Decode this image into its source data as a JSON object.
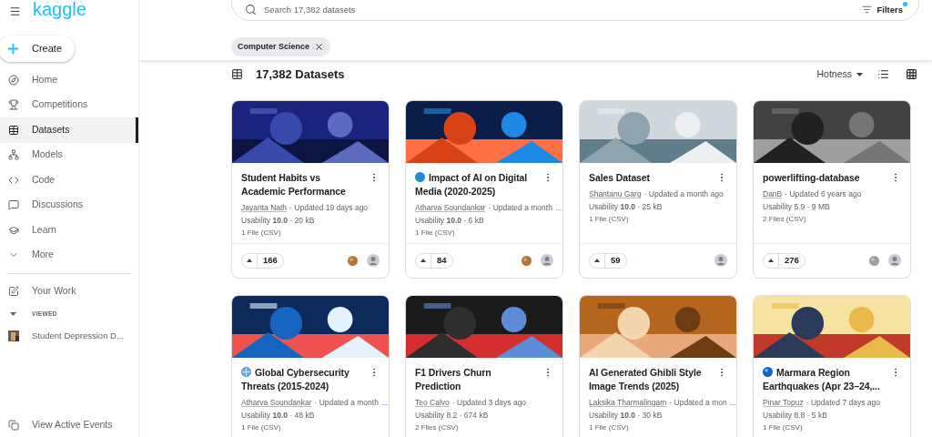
{
  "logo": "kaggle",
  "create_label": "Create",
  "nav": [
    {
      "label": "Home",
      "selected": false
    },
    {
      "label": "Competitions",
      "selected": false
    },
    {
      "label": "Datasets",
      "selected": true
    },
    {
      "label": "Models",
      "selected": false
    },
    {
      "label": "Code",
      "selected": false
    },
    {
      "label": "Discussions",
      "selected": false
    },
    {
      "label": "Learn",
      "selected": false
    },
    {
      "label": "More",
      "selected": false
    }
  ],
  "your_work": "Your Work",
  "viewed": {
    "heading": "VIEWED",
    "expanded": true,
    "items": [
      "Student Depression D..."
    ]
  },
  "active_events": "View Active Events",
  "search": {
    "placeholder": "Search 17,382 datasets"
  },
  "filters": {
    "label": "Filters",
    "active": true
  },
  "chips": [
    "Computer Science"
  ],
  "results_title": "17,382 Datasets",
  "sort": "Hotness",
  "views": [
    {
      "kind": "list",
      "selected": false
    },
    {
      "kind": "grid",
      "selected": false
    }
  ],
  "cards": [
    {
      "title": "Student Habits vs Academic Performance",
      "author": "Jayanta Nath",
      "updated": "· Updated 19 days ago",
      "usability": "Usability **10.0** · 20 kB",
      "files": "1 File (CSV)",
      "votes": "166",
      "medal": {
        "kind": "bronze"
      }
    },
    {
      "title_icon": {
        "kind": "earth"
      },
      "title": "Impact of AI on Digital Media (2020-2025)",
      "author": "Atharva Soundankar",
      "updated": "· Updated a month",
      "more": "...",
      "usability": "Usability **10.0** · 6 kB",
      "files": "1 File (CSV)",
      "votes": "84",
      "medal": {
        "kind": "bronze"
      }
    },
    {
      "title": "Sales Dataset",
      "author": "Shantanu Garg",
      "updated": "· Updated a month ago",
      "usability": "Usability **10.0** · 25 kB",
      "files": "1 File (CSV)",
      "votes": "59"
    },
    {
      "title": "powerlifting-database",
      "author": "DanB",
      "updated": "· Updated 6 years ago",
      "usability": "Usability 5.9 · 9 MB",
      "files": "2 Files (CSV)",
      "votes": "276",
      "medal": {
        "kind": "silver"
      }
    },
    {
      "title_icon": {
        "kind": "globe"
      },
      "title": "Global Cybersecurity Threats (2015-2024)",
      "author": "Atharva Soundankar",
      "updated": "· Updated a month",
      "more": "...",
      "usability": "Usability **10.0** · 48 kB",
      "files": "1 File (CSV)"
    },
    {
      "title": "F1 Drivers Churn Prediction",
      "author": "Teo Calvo",
      "updated": "· Updated 3 days ago",
      "usability": "Usability 8.2 · 674 kB",
      "files": "2 Files (CSV)"
    },
    {
      "title": "AI Generated Ghibli Style Image Trends (2025)",
      "author": "Laksika Tharmalingam",
      "updated": "· Updated a mon",
      "more": "...",
      "usability": "Usability **10.0** · 30 kB",
      "files": "1 File (CSV)"
    },
    {
      "title_icon": {
        "kind": "dot"
      },
      "title": "Marmara Region Earthquakes (Apr 23–24,...",
      "author": "Pinar Topuz",
      "updated": "· Updated 7 days ago",
      "usability": "Usability 8.8 · 5 kB",
      "files": "1 File (CSV)"
    }
  ]
}
